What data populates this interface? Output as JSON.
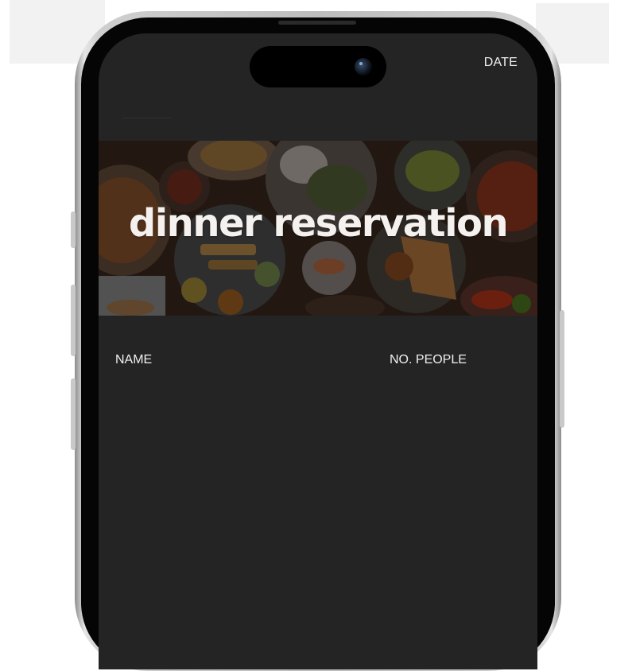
{
  "header": {
    "date_label": "DATE"
  },
  "hero": {
    "title": "dinner reservation"
  },
  "form": {
    "name_label": "NAME",
    "people_label": "NO. PEOPLE"
  },
  "colors": {
    "screen_background": "#242424",
    "text": "#f0f0f0"
  }
}
